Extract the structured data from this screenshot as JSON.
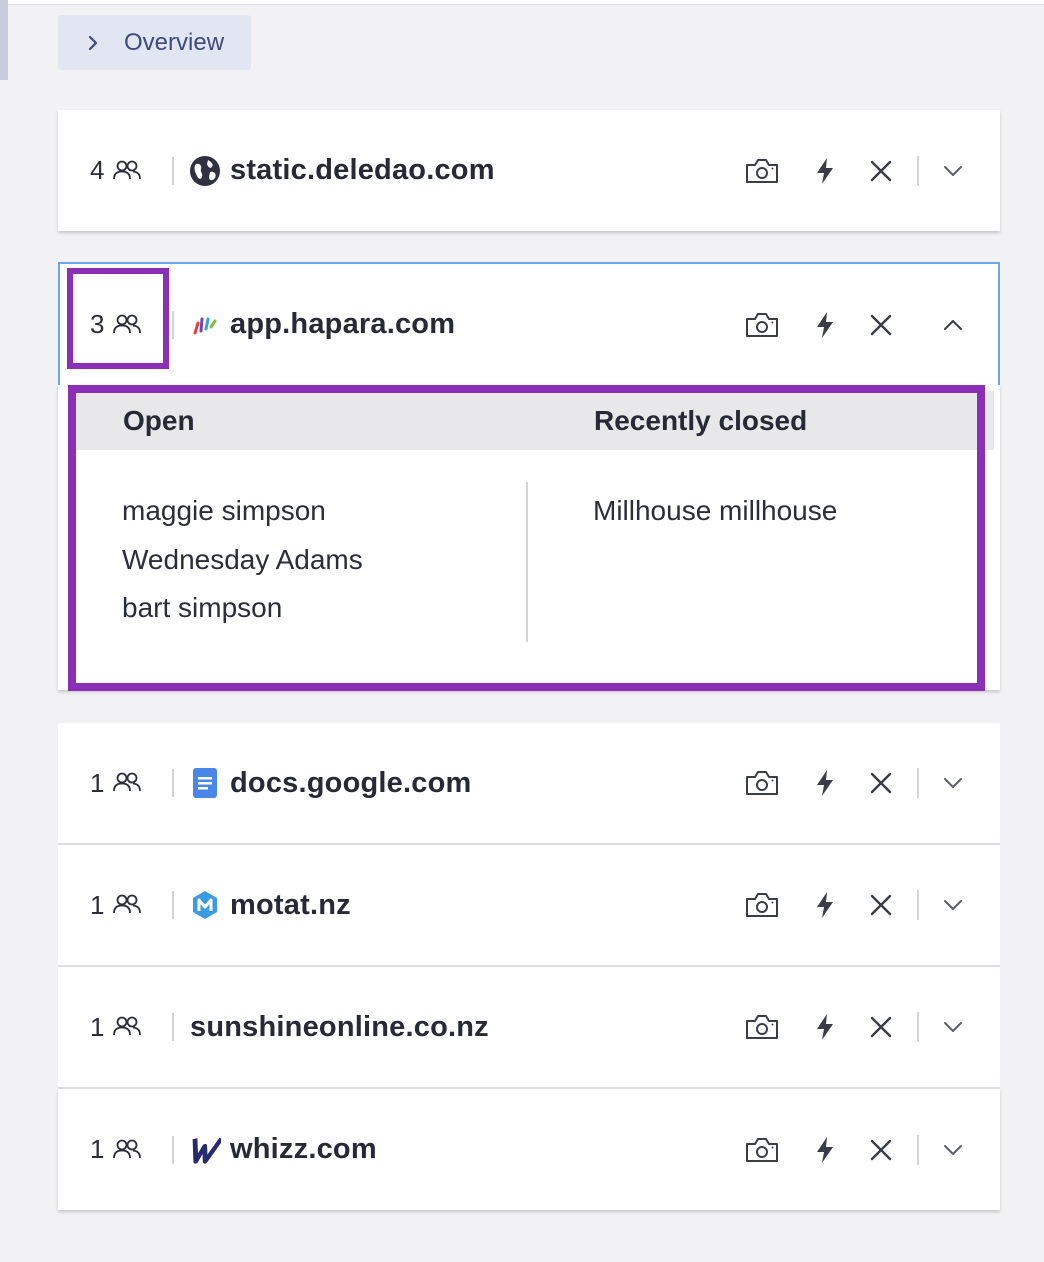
{
  "overview": {
    "label": "Overview"
  },
  "sites": [
    {
      "count": "4",
      "domain": "static.deledao.com",
      "favicon": "globe-icon",
      "expanded": false
    },
    {
      "count": "3",
      "domain": "app.hapara.com",
      "favicon": "hapara-icon",
      "expanded": true
    },
    {
      "count": "1",
      "domain": "docs.google.com",
      "favicon": "google-docs-icon",
      "expanded": false
    },
    {
      "count": "1",
      "domain": "motat.nz",
      "favicon": "motat-icon",
      "expanded": false
    },
    {
      "count": "1",
      "domain": "sunshineonline.co.nz",
      "favicon": "",
      "expanded": false
    },
    {
      "count": "1",
      "domain": "whizz.com",
      "favicon": "whizz-icon",
      "expanded": false
    }
  ],
  "detail": {
    "open_header": "Open",
    "closed_header": "Recently closed",
    "open": [
      "maggie simpson",
      "Wednesday Adams",
      "bart simpson"
    ],
    "closed": [
      "Millhouse millhouse"
    ]
  },
  "colors": {
    "highlight": "#8b2fb6",
    "active_border": "#6aa8ee",
    "overview_bg": "#e2e5f2",
    "google_docs": "#4a86e8",
    "motat": "#3b9ae1",
    "whizz": "#262a6e"
  }
}
